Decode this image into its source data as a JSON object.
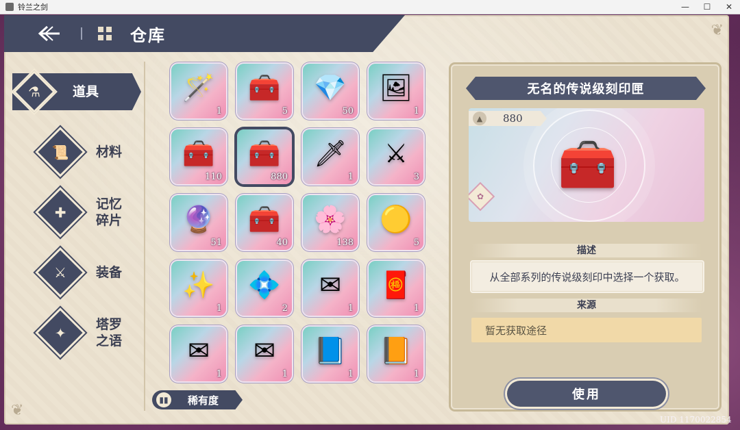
{
  "window": {
    "title": "铃兰之剑",
    "controls": [
      "—",
      "☐",
      "✕"
    ]
  },
  "header": {
    "back_icon": "back-arrow-icon",
    "grid_icon": "grid-icon",
    "title": "仓库"
  },
  "tabs": [
    {
      "label": "道具",
      "icon": "potion-icon",
      "glyph": "⚗",
      "active": true
    },
    {
      "label": "材料",
      "icon": "scroll-icon",
      "glyph": "📜",
      "active": false
    },
    {
      "label": "记忆\n碎片",
      "icon": "puzzle-icon",
      "glyph": "✚",
      "active": false
    },
    {
      "label": "装备",
      "icon": "equipment-icon",
      "glyph": "⚔",
      "active": false
    },
    {
      "label": "塔罗\n之语",
      "icon": "tarot-icon",
      "glyph": "✦",
      "active": false
    }
  ],
  "items": [
    {
      "name": "pink-wand-bundle",
      "glyph": "🪄",
      "qty": "1"
    },
    {
      "name": "golden-chest",
      "glyph": "🧰",
      "qty": "5"
    },
    {
      "name": "crystal-box",
      "glyph": "💎",
      "qty": "50"
    },
    {
      "name": "picture-frame",
      "glyph": "🖼",
      "qty": "1"
    },
    {
      "name": "red-chest",
      "glyph": "🧰",
      "qty": "110"
    },
    {
      "name": "legendary-seal-chest",
      "glyph": "🧰",
      "qty": "880",
      "selected": true
    },
    {
      "name": "pink-sword",
      "glyph": "🗡",
      "qty": "1"
    },
    {
      "name": "pink-sword-burst",
      "glyph": "⚔",
      "qty": "3"
    },
    {
      "name": "rainbow-crystals",
      "glyph": "🔮",
      "qty": "51"
    },
    {
      "name": "silver-chest",
      "glyph": "🧰",
      "qty": "40"
    },
    {
      "name": "pink-orb",
      "glyph": "🌸",
      "qty": "138"
    },
    {
      "name": "golden-orb",
      "glyph": "🟡",
      "qty": "5"
    },
    {
      "name": "star-emblem",
      "glyph": "✨",
      "qty": "1"
    },
    {
      "name": "rainbow-gem",
      "glyph": "💠",
      "qty": "2"
    },
    {
      "name": "sealed-letter",
      "glyph": "✉",
      "qty": "1"
    },
    {
      "name": "red-envelope",
      "glyph": "🧧",
      "qty": "1"
    },
    {
      "name": "leaf-letter",
      "glyph": "✉",
      "qty": "1"
    },
    {
      "name": "feather-letter",
      "glyph": "✉",
      "qty": "1"
    },
    {
      "name": "blue-book",
      "glyph": "📘",
      "qty": "1"
    },
    {
      "name": "brown-book",
      "glyph": "📙",
      "qty": "1"
    }
  ],
  "rarity_button": {
    "label": "稀有度",
    "icon": "rarity-icon"
  },
  "detail": {
    "title": "无名的传说级刻印匣",
    "owned_count": "880",
    "owned_icon": "bag-icon",
    "preview_glyph": "🧰",
    "description_heading": "描述",
    "description": "从全部系列的传说级刻印中选择一个获取。",
    "source_heading": "来源",
    "source": "暂无获取途径",
    "use_button": "使用"
  },
  "uid": "UID 1170022854",
  "colors": {
    "navy": "#434a62",
    "parchment": "#ece3d1",
    "panel": "#d9cdb2",
    "source_gold": "#f1d9a8"
  }
}
